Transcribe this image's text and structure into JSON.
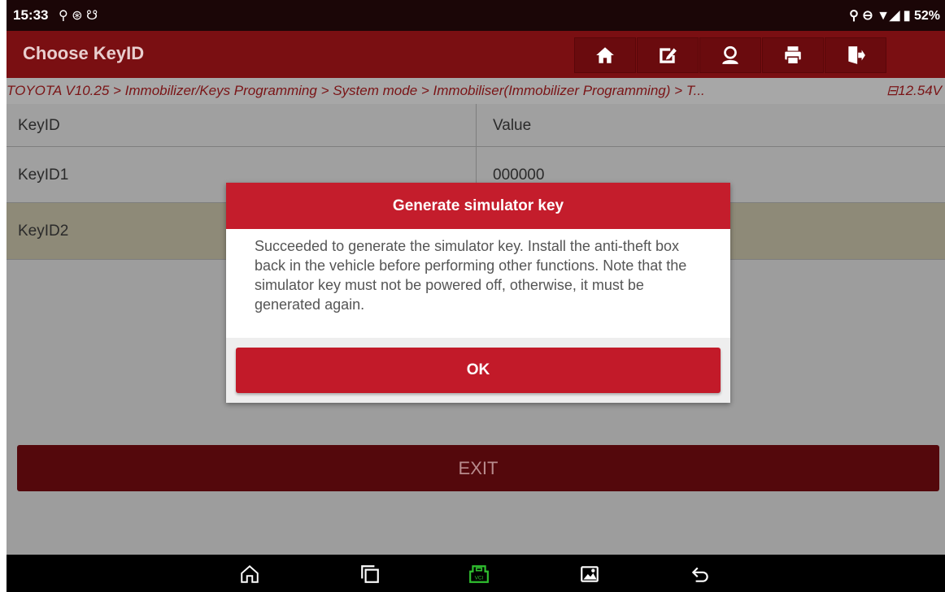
{
  "status_bar": {
    "time": "15:33",
    "left_icons": "⚲ ⊛ ☋",
    "right_icons": "⚲ ⊖ ▼◢",
    "battery": "52%"
  },
  "app_bar": {
    "title": "Choose KeyID",
    "buttons": [
      "home-icon",
      "edit-icon",
      "user-icon",
      "print-icon",
      "exit-door-icon"
    ]
  },
  "breadcrumb": {
    "path": "TOYOTA V10.25 > Immobilizer/Keys Programming > System mode > Immobiliser(Immobilizer Programming) > T...",
    "voltage": "12.54V"
  },
  "table": {
    "headers": [
      "KeyID",
      "Value"
    ],
    "rows": [
      {
        "key": "KeyID1",
        "value": "000000"
      },
      {
        "key": "KeyID2",
        "value": ""
      }
    ]
  },
  "exit_label": "EXIT",
  "dialog": {
    "title": "Generate simulator key",
    "message": "Succeeded to generate the simulator key. Install the anti-theft box back in the vehicle before performing other functions. Note that the simulator key must not be powered off, otherwise, it must be generated again.",
    "ok_label": "OK"
  },
  "nav_bar": {
    "icons": [
      "home-icon",
      "recent-apps-icon",
      "vci-icon",
      "gallery-icon",
      "back-icon"
    ],
    "vci_color": "#2fbf2f"
  }
}
